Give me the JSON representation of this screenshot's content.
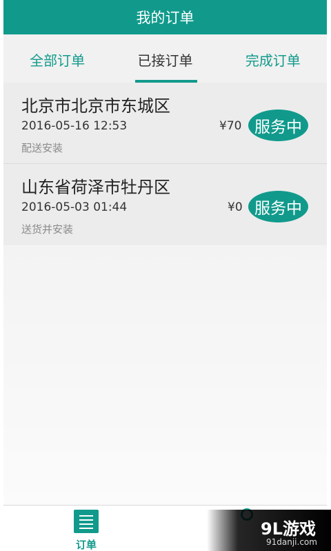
{
  "header": {
    "title": "我的订单"
  },
  "tabs": [
    {
      "label": "全部订单",
      "active": false
    },
    {
      "label": "已接订单",
      "active": true
    },
    {
      "label": "完成订单",
      "active": false
    }
  ],
  "orders": [
    {
      "address": "北京市北京市东城区",
      "time": "2016-05-16 12:53",
      "service": "配送安装",
      "price": "¥70",
      "status": "服务中"
    },
    {
      "address": "山东省荷泽市牡丹区",
      "time": "2016-05-03 01:44",
      "service": "送货并安装",
      "price": "¥0",
      "status": "服务中"
    }
  ],
  "bottom_nav": {
    "orders_label": "订单"
  },
  "watermark": {
    "main": "9L游戏",
    "sub": "91danji.com"
  },
  "colors": {
    "accent": "#119a8c"
  }
}
